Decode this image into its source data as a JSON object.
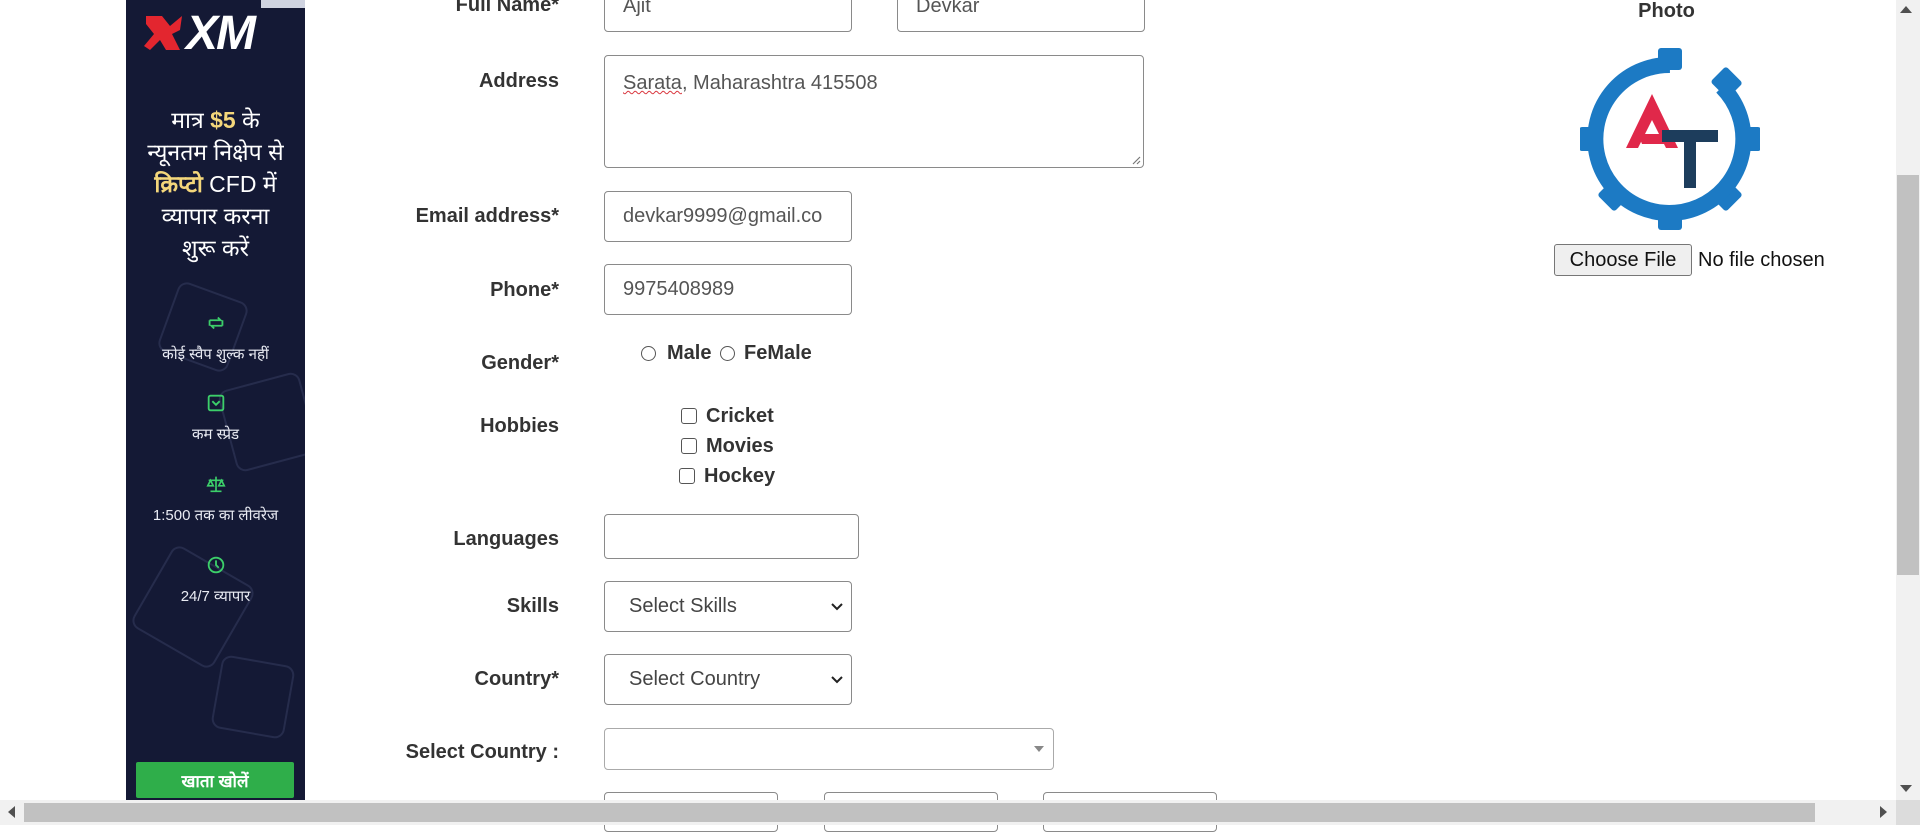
{
  "ad": {
    "brand": "XM",
    "headline_line1_a": "मात्र ",
    "headline_amount": "$5",
    "headline_line1_b": " के",
    "headline_line2": "न्यूनतम निक्षेप से",
    "headline_crypto": "क्रिप्टो",
    "headline_line3_b": " CFD में",
    "headline_line4": "व्यापार करना",
    "headline_line5": "शुरू करें",
    "features": [
      {
        "icon": "swap-icon",
        "label": "कोई स्वैप शुल्क नहीं"
      },
      {
        "icon": "spread-icon",
        "label": "कम स्प्रेड"
      },
      {
        "icon": "scale-icon",
        "label": "1:500 तक का लीवरेज"
      },
      {
        "icon": "clock-icon",
        "label": "24/7 व्यापार"
      }
    ],
    "cta": "खाता खोलें",
    "colors": {
      "background": "#141935",
      "cta": "#2fae4a",
      "accent": "#f4d77b",
      "logo_red": "#e3262f"
    }
  },
  "form": {
    "full_name": {
      "label": "Full Name*",
      "first": "Ajit",
      "last": "Devkar"
    },
    "address": {
      "label": "Address",
      "value_word1": "Sarata",
      "value_rest": ", Maharashtra 415508"
    },
    "email": {
      "label": "Email address*",
      "value": "devkar9999@gmail.co"
    },
    "phone": {
      "label": "Phone*",
      "value": "9975408989"
    },
    "gender": {
      "label": "Gender*",
      "options": [
        "Male",
        "FeMale"
      ]
    },
    "hobbies": {
      "label": "Hobbies",
      "options": [
        "Cricket",
        "Movies",
        "Hockey"
      ]
    },
    "languages": {
      "label": "Languages",
      "value": ""
    },
    "skills": {
      "label": "Skills",
      "selected": "Select Skills"
    },
    "country": {
      "label": "Country*",
      "selected": "Select Country"
    },
    "select_country": {
      "label": "Select Country :",
      "selected": ""
    }
  },
  "photo": {
    "title": "Photo",
    "button": "Choose File",
    "status": "No file chosen",
    "logo_colors": {
      "gear": "#1c7ac4",
      "a": "#e0284a",
      "t": "#1d3d5c"
    }
  }
}
